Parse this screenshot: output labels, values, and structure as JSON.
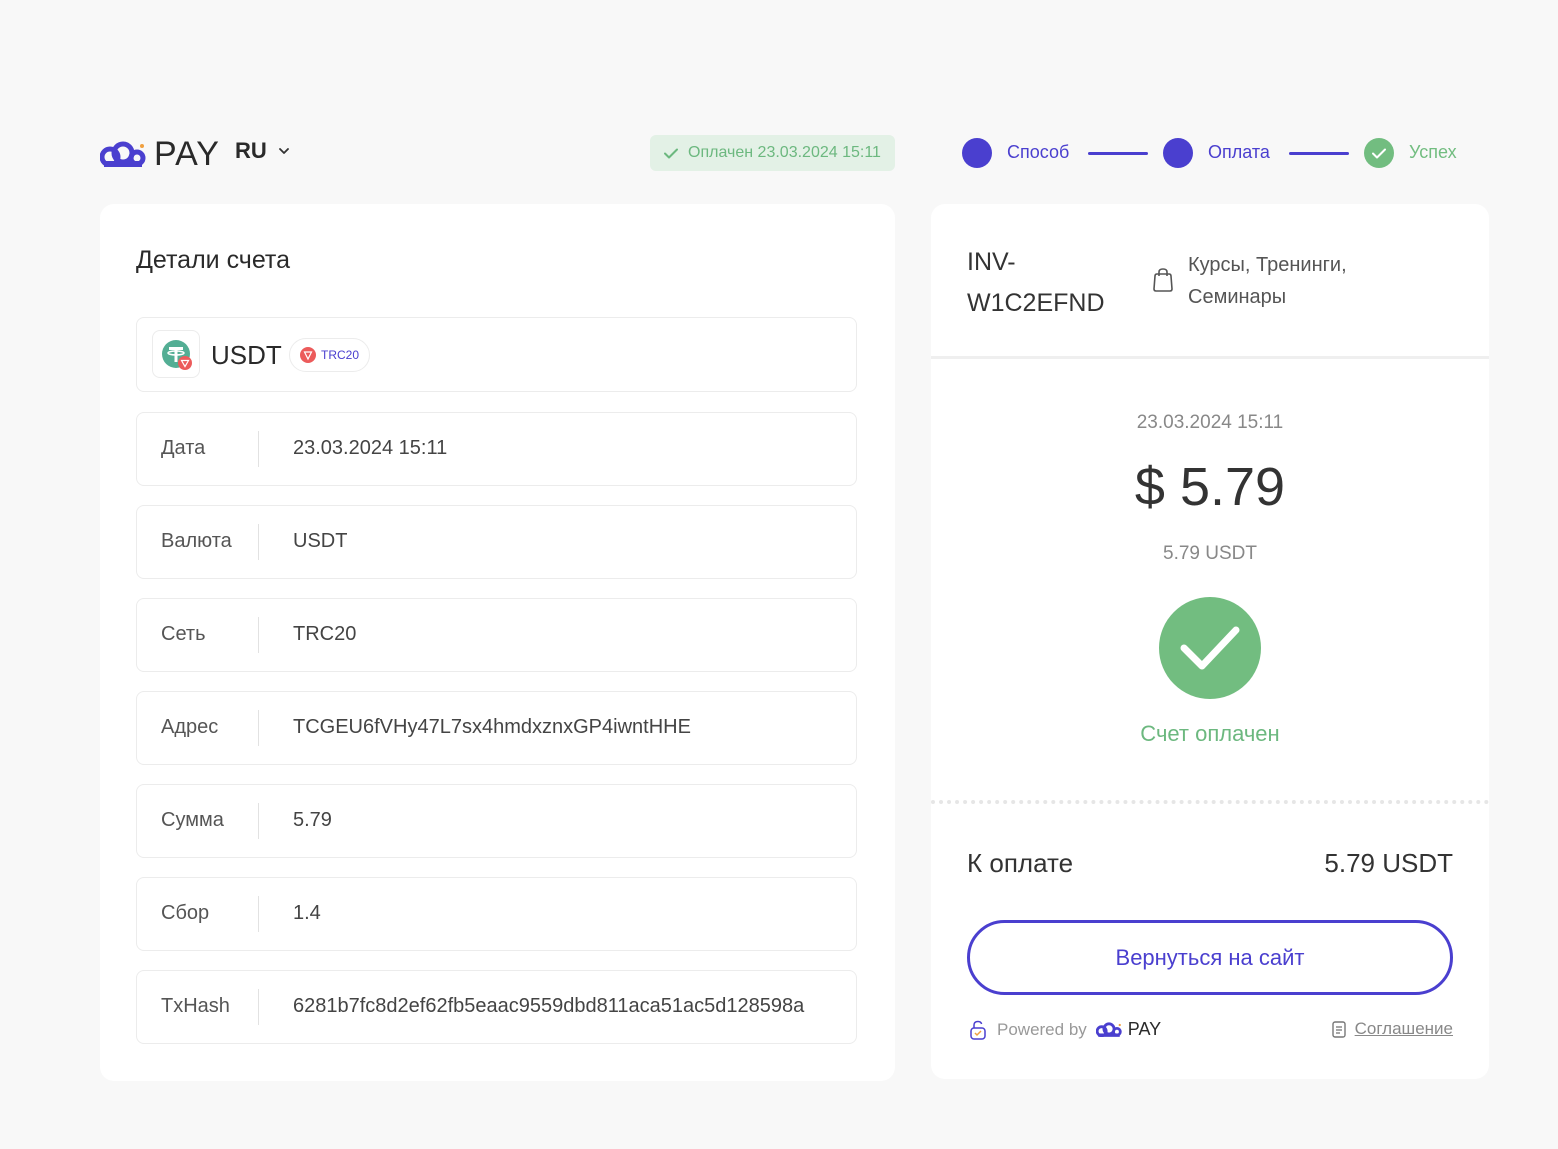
{
  "header": {
    "brand": "PAY",
    "language": "RU",
    "status_badge": "Оплачен 23.03.2024 15:11",
    "steps": [
      {
        "label": "Способ",
        "state": "done"
      },
      {
        "label": "Оплата",
        "state": "done"
      },
      {
        "label": "Успех",
        "state": "success"
      }
    ]
  },
  "details": {
    "title": "Детали счета",
    "coin": "USDT",
    "network_badge": "TRC20",
    "rows": [
      {
        "label": "Дата",
        "value": "23.03.2024 15:11"
      },
      {
        "label": "Валюта",
        "value": "USDT"
      },
      {
        "label": "Сеть",
        "value": "TRC20"
      },
      {
        "label": "Адрес",
        "value": "TCGEU6fVHy47L7sx4hmdxznxGP4iwntHHE"
      },
      {
        "label": "Сумма",
        "value": "5.79"
      },
      {
        "label": "Сбор",
        "value": "1.4"
      },
      {
        "label": "TxHash",
        "value": "6281b7fc8d2ef62fb5eaac9559dbd811aca51ac5d128598a"
      }
    ]
  },
  "invoice": {
    "id": "INV-W1C2EFND",
    "category": "Курсы, Тренинги, Семинары",
    "date": "23.03.2024 15:11",
    "amount": "$ 5.79",
    "amount_crypto": "5.79 USDT",
    "status_text": "Счет оплачен",
    "due_label": "К оплате",
    "due_value": "5.79 USDT",
    "back_button": "Вернуться на сайт",
    "powered_by": "Powered by",
    "powered_brand": "PAY",
    "agreement": "Соглашение"
  },
  "colors": {
    "accent": "#4a3fcf",
    "success": "#72bd80",
    "success_bg": "#e3f1e6"
  }
}
